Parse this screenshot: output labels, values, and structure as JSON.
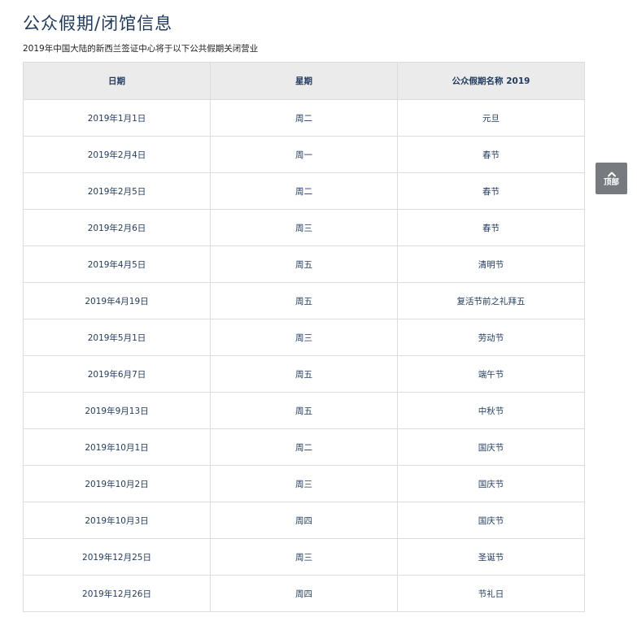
{
  "page": {
    "title": "公众假期/闭馆信息",
    "intro": "2019年中国大陆的新西兰签证中心将于以下公共假期关闭营业"
  },
  "table": {
    "headers": [
      "日期",
      "星期",
      "公众假期名称 2019"
    ],
    "rows": [
      [
        "2019年1月1日",
        "周二",
        "元旦"
      ],
      [
        "2019年2月4日",
        "周一",
        "春节"
      ],
      [
        "2019年2月5日",
        "周二",
        "春节"
      ],
      [
        "2019年2月6日",
        "周三",
        "春节"
      ],
      [
        "2019年4月5日",
        "周五",
        "清明节"
      ],
      [
        "2019年4月19日",
        "周五",
        "复活节前之礼拜五"
      ],
      [
        "2019年5月1日",
        "周三",
        "劳动节"
      ],
      [
        "2019年6月7日",
        "周五",
        "端午节"
      ],
      [
        "2019年9月13日",
        "周五",
        "中秋节"
      ],
      [
        "2019年10月1日",
        "周二",
        "国庆节"
      ],
      [
        "2019年10月2日",
        "周三",
        "国庆节"
      ],
      [
        "2019年10月3日",
        "周四",
        "国庆节"
      ],
      [
        "2019年12月25日",
        "周三",
        "圣诞节"
      ],
      [
        "2019年12月26日",
        "周四",
        "节礼日"
      ]
    ]
  },
  "back_to_top": {
    "icon": "chevron-up-icon",
    "label": "顶部"
  },
  "colors": {
    "text_primary": "#1f3a5f",
    "header_bg": "#ebebeb",
    "border": "#dcdcdc",
    "back_to_top_bg": "#777a7e"
  }
}
